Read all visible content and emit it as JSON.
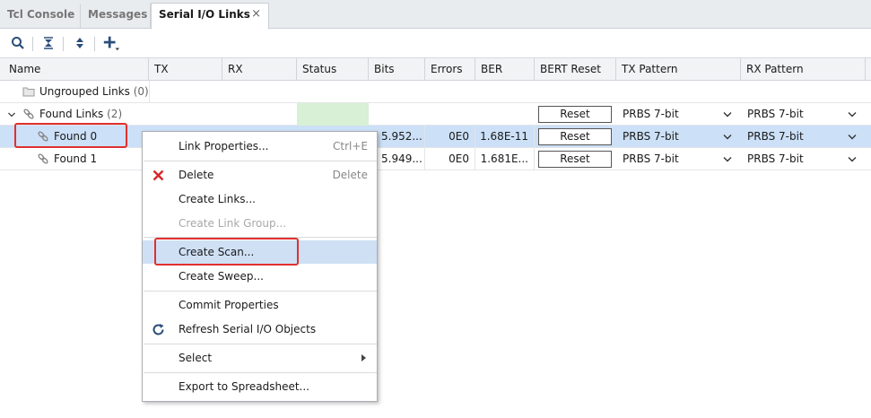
{
  "tabs": [
    {
      "label": "Tcl Console",
      "active": false
    },
    {
      "label": "Messages",
      "active": false
    },
    {
      "label": "Serial I/O Links",
      "active": true
    }
  ],
  "tab_close_glyph": "×",
  "toolbar": {
    "icons": [
      "search-icon",
      "collapse-all-icon",
      "expand-all-icon",
      "add-icon"
    ]
  },
  "table": {
    "columns": [
      "Name",
      "TX",
      "RX",
      "Status",
      "Bits",
      "Errors",
      "BER",
      "BERT Reset",
      "TX Pattern",
      "RX Pattern"
    ],
    "groups": [
      {
        "label": "Ungrouped Links",
        "count": "(0)"
      },
      {
        "label": "Found Links",
        "count": "(2)"
      }
    ],
    "links": [
      {
        "name": "Found 0",
        "bits": "5.952...",
        "errors": "0E0",
        "ber": "1.68E-11",
        "bert_reset": "Reset",
        "tx_pattern": "PRBS 7-bit",
        "rx_pattern": "PRBS 7-bit",
        "selected": true
      },
      {
        "name": "Found 1",
        "bits": "5.949...",
        "errors": "0E0",
        "ber": "1.681E...",
        "bert_reset": "Reset",
        "tx_pattern": "PRBS 7-bit",
        "rx_pattern": "PRBS 7-bit",
        "selected": false
      }
    ],
    "group_bert_reset": "Reset",
    "group_tx_pattern": "PRBS 7-bit",
    "group_rx_pattern": "PRBS 7-bit"
  },
  "context_menu": {
    "items": [
      {
        "label": "Link Properties...",
        "shortcut": "Ctrl+E",
        "icon": ""
      },
      {
        "label": "Delete",
        "shortcut": "Delete",
        "icon": "delete-icon"
      },
      {
        "label": "Create Links...",
        "shortcut": "",
        "icon": ""
      },
      {
        "label": "Create Link Group...",
        "shortcut": "",
        "icon": "",
        "disabled": true
      },
      {
        "label": "Create Scan...",
        "shortcut": "",
        "icon": "",
        "highlighted": true
      },
      {
        "label": "Create Sweep...",
        "shortcut": "",
        "icon": ""
      },
      {
        "label": "Commit Properties",
        "shortcut": "",
        "icon": ""
      },
      {
        "label": "Refresh Serial I/O Objects",
        "shortcut": "",
        "icon": "refresh-icon"
      },
      {
        "label": "Select",
        "shortcut": "",
        "icon": "",
        "submenu": true
      },
      {
        "label": "Export to Spreadsheet...",
        "shortcut": "",
        "icon": ""
      }
    ]
  },
  "colors": {
    "selection": "#cce0f7",
    "highlight_box": "#e0302e",
    "status_ok": "#d8f0d5",
    "menu_hover": "#cfe0f5"
  }
}
